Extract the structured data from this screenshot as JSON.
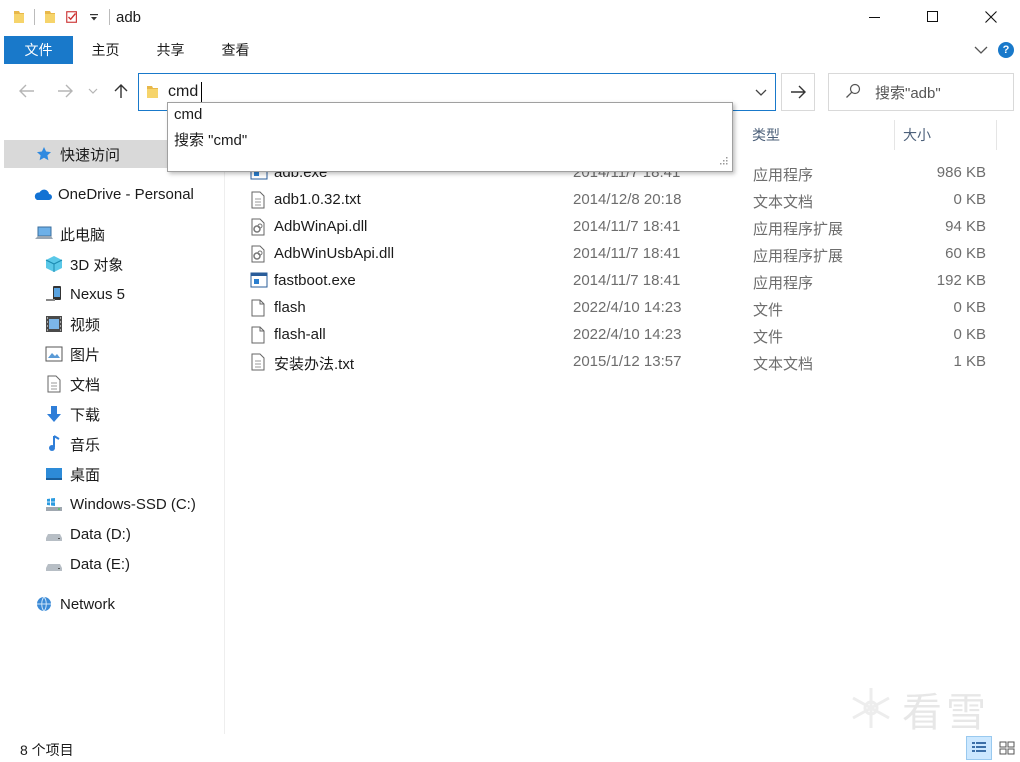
{
  "window": {
    "title": "adb",
    "minimize_glyph": "—",
    "close_glyph": "✕"
  },
  "ribbon": {
    "file_tab": "文件",
    "tabs": [
      "主页",
      "共享",
      "查看"
    ]
  },
  "address": {
    "value": "cmd",
    "search_placeholder": "搜索\"adb\""
  },
  "suggestions": [
    "cmd",
    "搜索 \"cmd\""
  ],
  "nav": {
    "quick_access": "快速访问",
    "onedrive": "OneDrive - Personal",
    "this_pc": "此电脑",
    "pc_items": [
      "3D 对象",
      "Nexus 5",
      "视频",
      "图片",
      "文档",
      "下载",
      "音乐",
      "桌面",
      "Windows-SSD (C:)",
      "Data (D:)",
      "Data (E:)"
    ],
    "network": "Network"
  },
  "columns": {
    "type": "类型",
    "size": "大小"
  },
  "files": [
    {
      "name": "adb.exe",
      "date": "2014/11/7 18:41",
      "type": "应用程序",
      "size": "986 KB",
      "icon": "exe-icon"
    },
    {
      "name": "adb1.0.32.txt",
      "date": "2014/12/8 20:18",
      "type": "文本文档",
      "size": "0 KB",
      "icon": "txt-icon"
    },
    {
      "name": "AdbWinApi.dll",
      "date": "2014/11/7 18:41",
      "type": "应用程序扩展",
      "size": "94 KB",
      "icon": "dll-icon"
    },
    {
      "name": "AdbWinUsbApi.dll",
      "date": "2014/11/7 18:41",
      "type": "应用程序扩展",
      "size": "60 KB",
      "icon": "dll-icon"
    },
    {
      "name": "fastboot.exe",
      "date": "2014/11/7 18:41",
      "type": "应用程序",
      "size": "192 KB",
      "icon": "exe-icon"
    },
    {
      "name": "flash",
      "date": "2022/4/10 14:23",
      "type": "文件",
      "size": "0 KB",
      "icon": "file-icon"
    },
    {
      "name": "flash-all",
      "date": "2022/4/10 14:23",
      "type": "文件",
      "size": "0 KB",
      "icon": "file-icon"
    },
    {
      "name": "安装办法.txt",
      "date": "2015/1/12 13:57",
      "type": "文本文档",
      "size": "1 KB",
      "icon": "txt-icon"
    }
  ],
  "status": {
    "item_count": "8 个项目"
  },
  "watermark": "看雪",
  "colors": {
    "accent": "#1979ca",
    "selected_bg": "#cce8ff",
    "muted_text": "#6d6d6d"
  }
}
